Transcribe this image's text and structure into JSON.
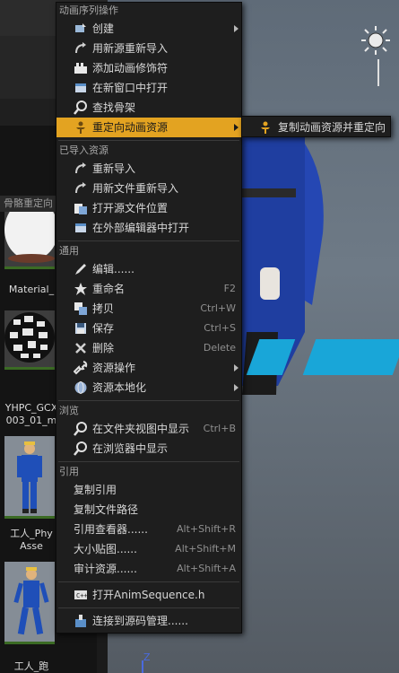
{
  "asset_browser": {
    "header_label": "骨骼重定向",
    "thumbnails": [
      {
        "label_lines": [
          "Material_"
        ],
        "kind": "sphere-white"
      },
      {
        "label_lines": [
          "YHPC_GCX",
          "003_01_m"
        ],
        "kind": "sphere-pattern"
      },
      {
        "label_lines": [
          "工人_Phy",
          "Asse"
        ],
        "kind": "worker"
      },
      {
        "label_lines": [
          "工人_跑"
        ],
        "kind": "worker"
      }
    ]
  },
  "viewport": {
    "axis_label": "Z"
  },
  "context_menu": {
    "sections": [
      {
        "header": "动画序列操作",
        "items": [
          {
            "label": "创建",
            "icon": "create-icon",
            "submenu": true
          },
          {
            "label": "用新源重新导入",
            "icon": "reimport-icon"
          },
          {
            "label": "添加动画修饰符",
            "icon": "modifier-icon"
          },
          {
            "label": "在新窗口中打开",
            "icon": "open-window-icon"
          },
          {
            "label": "查找骨架",
            "icon": "find-skeleton-icon"
          },
          {
            "label": "重定向动画资源",
            "icon": "retarget-icon",
            "submenu": true,
            "highlighted": true
          }
        ]
      },
      {
        "header": "已导入资源",
        "items": [
          {
            "label": "重新导入",
            "icon": "reimport-icon"
          },
          {
            "label": "用新文件重新导入",
            "icon": "reimport-file-icon"
          },
          {
            "label": "打开源文件位置",
            "icon": "folder-open-icon"
          },
          {
            "label": "在外部编辑器中打开",
            "icon": "external-editor-icon"
          }
        ]
      },
      {
        "header": "通用",
        "items": [
          {
            "label": "编辑......",
            "icon": "edit-icon"
          },
          {
            "label": "重命名",
            "icon": "rename-icon",
            "shortcut": "F2"
          },
          {
            "label": "拷贝",
            "icon": "copy-icon",
            "shortcut": "Ctrl+W"
          },
          {
            "label": "保存",
            "icon": "save-icon",
            "shortcut": "Ctrl+S"
          },
          {
            "label": "删除",
            "icon": "delete-icon",
            "shortcut": "Delete"
          },
          {
            "label": "资源操作",
            "icon": "wrench-icon",
            "submenu": true
          },
          {
            "label": "资源本地化",
            "icon": "globe-icon",
            "submenu": true
          }
        ]
      },
      {
        "header": "浏览",
        "items": [
          {
            "label": "在文件夹视图中显示",
            "icon": "search-icon",
            "shortcut": "Ctrl+B"
          },
          {
            "label": "在浏览器中显示",
            "icon": "search-icon"
          }
        ]
      },
      {
        "header": "引用",
        "items": [
          {
            "label": "复制引用"
          },
          {
            "label": "复制文件路径"
          },
          {
            "label": "引用查看器......",
            "shortcut": "Alt+Shift+R"
          },
          {
            "label": "大小贴图......",
            "shortcut": "Alt+Shift+M"
          },
          {
            "label": "审计资源......",
            "shortcut": "Alt+Shift+A"
          }
        ]
      },
      {
        "items": [
          {
            "label": "打开AnimSequence.h",
            "icon": "code-file-icon"
          }
        ]
      },
      {
        "items": [
          {
            "label": "连接到源码管理......",
            "icon": "source-control-icon"
          }
        ]
      }
    ],
    "submenu": {
      "items": [
        {
          "label": "复制动画资源并重定向",
          "icon": "retarget-duplicate-icon"
        }
      ]
    }
  },
  "colors": {
    "highlight": "#e3a321",
    "menu_bg": "#1e1e1e",
    "floor_marker": "#19a6d8"
  }
}
